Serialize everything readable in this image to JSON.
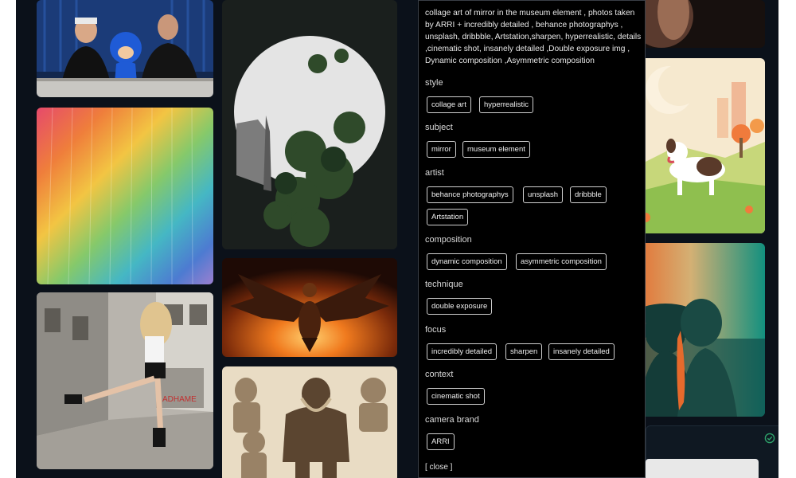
{
  "prompt": {
    "text": "collage art of mirror in the museum element , photos taken by ARRI + incredibly detailed , behance photographys , unsplash, dribbble, Artstation,sharpen, hyperrealistic, details ,cinematic shot, insanely detailed ,Double exposure img , Dynamic composition ,Asymmetric composition"
  },
  "sections": [
    {
      "title": "style",
      "tags": [
        "collage art",
        "hyperrealistic"
      ]
    },
    {
      "title": "subject",
      "tags": [
        "mirror",
        "museum element"
      ]
    },
    {
      "title": "artist",
      "tags": [
        "behance photographys",
        "unsplash",
        "dribbble",
        "Artstation"
      ]
    },
    {
      "title": "composition",
      "tags": [
        "dynamic composition",
        "asymmetric composition"
      ]
    },
    {
      "title": "technique",
      "tags": [
        "double exposure"
      ]
    },
    {
      "title": "focus",
      "tags": [
        "incredibly detailed",
        "sharpen",
        "insanely detailed"
      ]
    },
    {
      "title": "context",
      "tags": [
        "cinematic shot"
      ]
    },
    {
      "title": "camera brand",
      "tags": [
        "ARRI"
      ]
    }
  ],
  "close_label": "[ close ]",
  "gallery": {
    "images": [
      "podcast-with-sonic",
      "rainbow-texture",
      "dancing-woman-street",
      "mirror-double-exposure",
      "fire-eagle",
      "warrior-sketch",
      "portrait-top-right",
      "dog-meadow",
      "couple-silhouette"
    ],
    "graffiti_text": "ADHAME"
  },
  "colors": {
    "background": "#0b111a",
    "panel": "#000000",
    "tag_border": "#cfcfcf",
    "accent": "#2ea36b"
  }
}
